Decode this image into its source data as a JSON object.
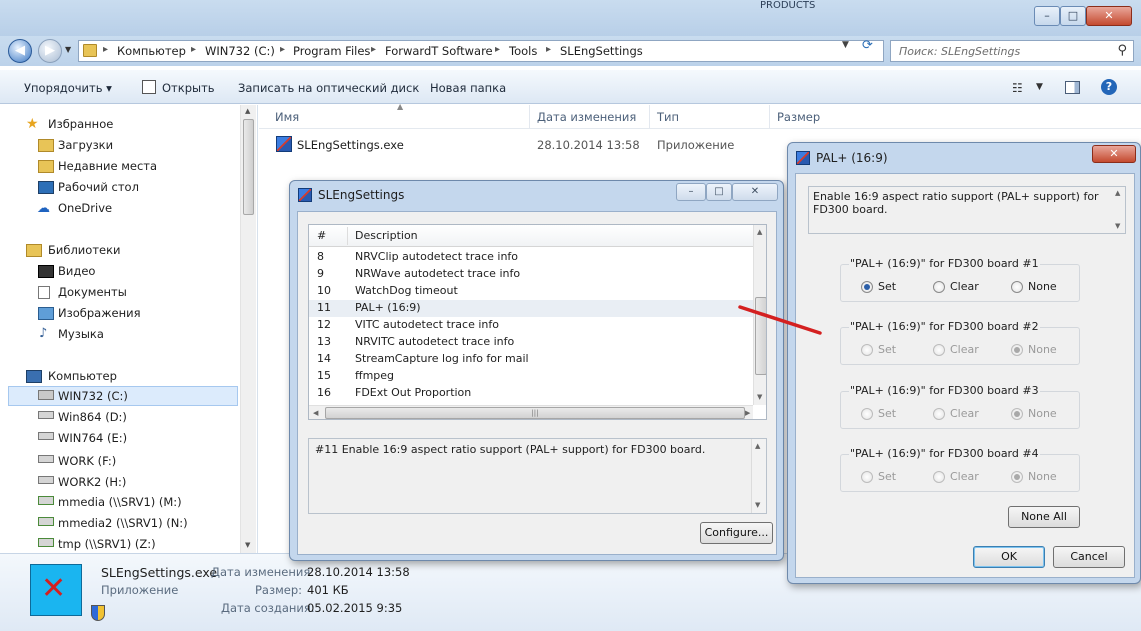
{
  "titlebar": {
    "caption_right": "PRODUCTS",
    "caption_left": "",
    "min": "–",
    "max": "□",
    "close": "✕"
  },
  "nav": {
    "crumbs": [
      "Компьютер",
      "WIN732 (C:)",
      "Program Files",
      "ForwardT Software",
      "Tools",
      "SLEngSettings"
    ],
    "search_placeholder": "Поиск: SLEngSettings"
  },
  "toolbar": {
    "organize": "Упорядочить ▾",
    "open": "Открыть",
    "burn": "Записать на оптический диск",
    "new_folder": "Новая папка"
  },
  "sidebar": {
    "favorites": "Избранное",
    "downloads": "Загрузки",
    "recent": "Недавние места",
    "desktop": "Рабочий стол",
    "onedrive": "OneDrive",
    "libraries": "Библиотеки",
    "video": "Видео",
    "documents": "Документы",
    "pictures": "Изображения",
    "music": "Музыка",
    "computer": "Компьютер",
    "drives": [
      "WIN732 (C:)",
      "Win864 (D:)",
      "WIN764 (E:)",
      "WORK (F:)",
      "WORK2 (H:)",
      "mmedia (\\\\SRV1) (M:)",
      "mmedia2 (\\\\SRV1) (N:)",
      "tmp (\\\\SRV1) (Z:)"
    ]
  },
  "columns": {
    "name": "Имя",
    "date": "Дата изменения",
    "type": "Тип",
    "size": "Размер"
  },
  "file": {
    "name": "SLEngSettings.exe",
    "date": "28.10.2014 13:58",
    "type": "Приложение",
    "size": ""
  },
  "details": {
    "name": "SLEngSettings.exe",
    "kind": "Приложение",
    "modified_label": "Дата изменения:",
    "modified": "28.10.2014 13:58",
    "size_label": "Размер:",
    "size": "401 КБ",
    "created_label": "Дата создания:",
    "created": "05.02.2015 9:35"
  },
  "sleng": {
    "title": "SLEngSettings",
    "col_num": "#",
    "col_desc": "Description",
    "rows": [
      {
        "n": "8",
        "d": "NRVClip autodetect trace info"
      },
      {
        "n": "9",
        "d": "NRWave autodetect trace info"
      },
      {
        "n": "10",
        "d": "WatchDog timeout"
      },
      {
        "n": "11",
        "d": "PAL+  (16:9)"
      },
      {
        "n": "12",
        "d": "VITC autodetect trace info"
      },
      {
        "n": "13",
        "d": "NRVITC autodetect trace info"
      },
      {
        "n": "14",
        "d": "StreamCapture log info for mail"
      },
      {
        "n": "15",
        "d": "ffmpeg"
      },
      {
        "n": "16",
        "d": "FDExt Out Proportion"
      }
    ],
    "description": "#11   Enable 16:9 aspect ratio support (PAL+  support) for FD300 board.",
    "configure": "Configure..."
  },
  "pal": {
    "title": "PAL+  (16:9)",
    "description": "Enable 16:9 aspect ratio support (PAL+  support) for FD300 board.",
    "groups": [
      {
        "label": "\"PAL+  (16:9)\" for FD300 board #1",
        "selected": "set",
        "enabled": true
      },
      {
        "label": "\"PAL+  (16:9)\" for FD300 board #2",
        "selected": "none",
        "enabled": false
      },
      {
        "label": "\"PAL+  (16:9)\" for FD300 board #3",
        "selected": "none",
        "enabled": false
      },
      {
        "label": "\"PAL+  (16:9)\" for FD300 board #4",
        "selected": "none",
        "enabled": false
      }
    ],
    "opt_set": "Set",
    "opt_clear": "Clear",
    "opt_none": "None",
    "none_all": "None All",
    "ok": "OK",
    "cancel": "Cancel"
  },
  "colors": {
    "annotation_arrow": "#d42020",
    "selection": "#dcebfc"
  }
}
